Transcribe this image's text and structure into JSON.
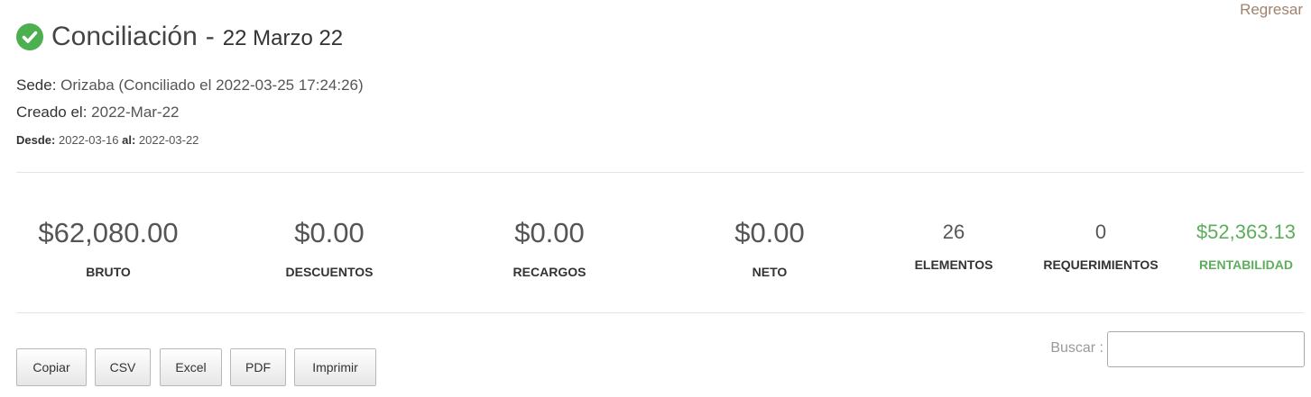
{
  "header": {
    "back_link": "Regresar",
    "title": "Conciliación",
    "separator": "-",
    "title_date": "22 Marzo 22",
    "status_icon": "check-circle-icon",
    "status_color": "#4caf50"
  },
  "info": {
    "sede_label": "Sede:",
    "sede_value": "Orizaba (Conciliado el 2022-03-25 17:24:26)",
    "created_label": "Creado el:",
    "created_value": "2022-Mar-22",
    "from_label": "Desde:",
    "from_value": "2022-03-16",
    "to_label": "al:",
    "to_value": "2022-03-22"
  },
  "stats": [
    {
      "value": "$62,080.00",
      "label": "BRUTO"
    },
    {
      "value": "$0.00",
      "label": "DESCUENTOS"
    },
    {
      "value": "$0.00",
      "label": "RECARGOS"
    },
    {
      "value": "$0.00",
      "label": "NETO"
    },
    {
      "value": "26",
      "label": "ELEMENTOS"
    },
    {
      "value": "0",
      "label": "REQUERIMIENTOS"
    },
    {
      "value": "$52,363.13",
      "label": "RENTABILIDAD",
      "color": "#5cae5c"
    }
  ],
  "toolbar": {
    "copy_label": "Copiar",
    "csv_label": "CSV",
    "excel_label": "Excel",
    "pdf_label": "PDF",
    "print_label": "Imprimir"
  },
  "search": {
    "label": "Buscar :",
    "value": ""
  }
}
